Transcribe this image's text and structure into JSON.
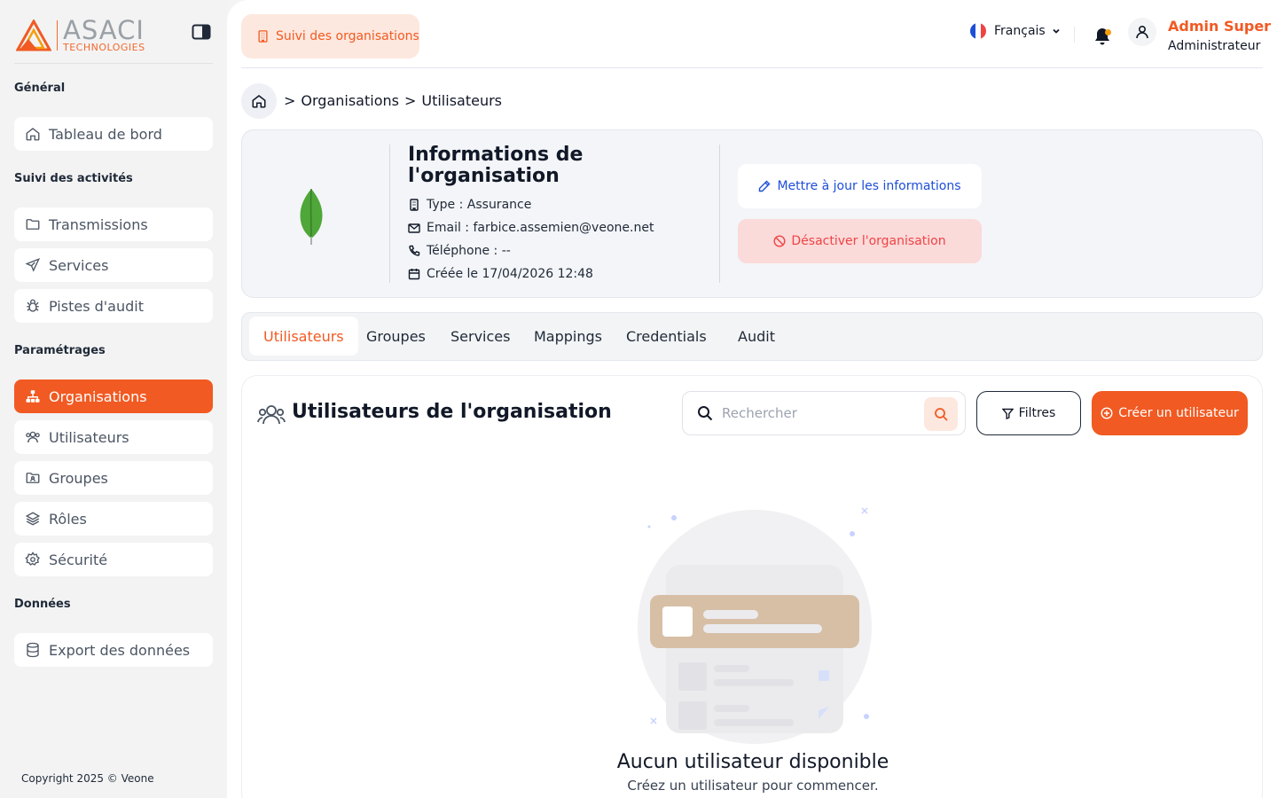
{
  "brand": {
    "name": "ASACI",
    "sub": "TECHNOLOGIES",
    "accent": "#f15a22"
  },
  "sidebar": {
    "sections": [
      {
        "title": "Général",
        "items": [
          {
            "label": "Tableau de bord",
            "icon": "home-icon"
          }
        ]
      },
      {
        "title": "Suivi des activités",
        "items": [
          {
            "label": "Transmissions",
            "icon": "folder-icon"
          },
          {
            "label": "Services",
            "icon": "send-icon"
          },
          {
            "label": "Pistes d'audit",
            "icon": "bug-icon"
          }
        ]
      },
      {
        "title": "Paramétrages",
        "items": [
          {
            "label": "Organisations",
            "icon": "sitemap-icon",
            "active": true
          },
          {
            "label": "Utilisateurs",
            "icon": "users-icon"
          },
          {
            "label": "Groupes",
            "icon": "folder-user-icon"
          },
          {
            "label": "Rôles",
            "icon": "layers-icon"
          },
          {
            "label": "Sécurité",
            "icon": "gear-icon"
          }
        ]
      },
      {
        "title": "Données",
        "items": [
          {
            "label": "Export des données",
            "icon": "database-icon"
          }
        ]
      }
    ],
    "copyright": "Copyright 2025 © Veone"
  },
  "topbar": {
    "chip": "Suivi des organisations",
    "language": "Français",
    "user": {
      "name": "Admin Super",
      "role": "Administrateur"
    }
  },
  "breadcrumb": {
    "sep": ">",
    "items": [
      "Organisations",
      "Utilisateurs"
    ]
  },
  "org": {
    "title": "Informations de l'organisation",
    "type": "Type : Assurance",
    "email": "Email : farbice.assemien@veone.net",
    "phone": "Téléphone : --",
    "created": "Créée le 17/04/2026 12:48",
    "update_label": "Mettre à jour les informations",
    "deactivate_label": "Désactiver l'organisation"
  },
  "tabs": [
    "Utilisateurs",
    "Groupes",
    "Services",
    "Mappings",
    "Credentials",
    "Audit"
  ],
  "panel": {
    "title": "Utilisateurs de l'organisation",
    "search_placeholder": "Rechercher",
    "filter_label": "Filtres",
    "create_label": "Créer un utilisateur",
    "empty_title": "Aucun utilisateur disponible",
    "empty_sub": "Créez un utilisateur pour commencer."
  }
}
